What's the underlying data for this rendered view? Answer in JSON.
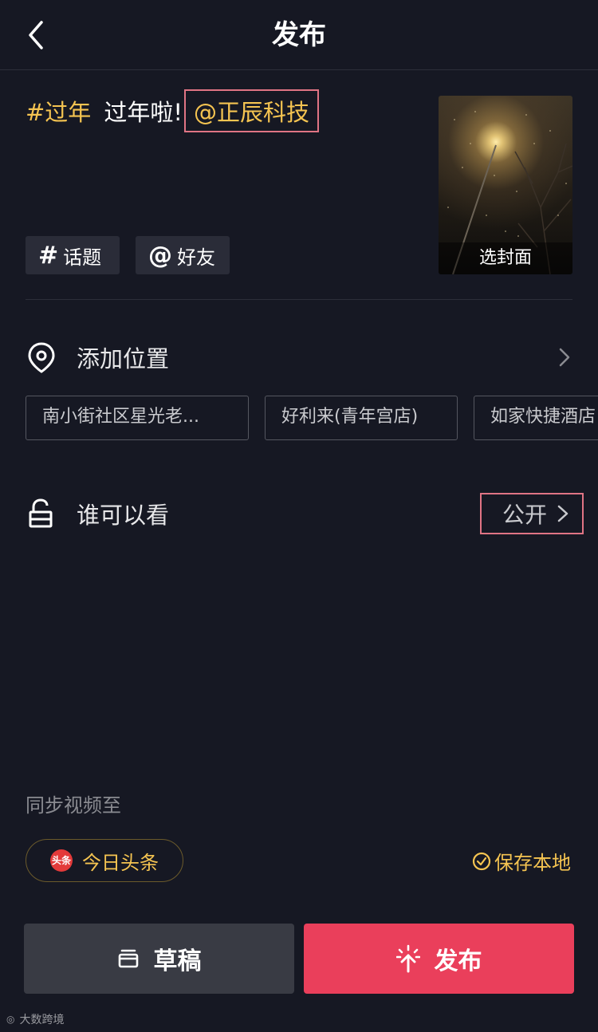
{
  "header": {
    "title": "发布",
    "back_icon": "chevron-left-icon"
  },
  "caption": {
    "hashtag": "#过年",
    "text": "过年啦!",
    "mention": "@正辰科技"
  },
  "chips": {
    "topic": {
      "glyph": "#",
      "label": "话题"
    },
    "friend": {
      "glyph": "@",
      "label": "好友"
    }
  },
  "cover": {
    "label": "选封面"
  },
  "location": {
    "label": "添加位置",
    "icon": "location-pin-icon",
    "suggestions": [
      "南小街社区星光老...",
      "好利来(青年宫店)",
      "如家快捷酒店"
    ]
  },
  "privacy": {
    "label": "谁可以看",
    "value": "公开",
    "icon": "unlock-icon"
  },
  "sync": {
    "label": "同步视频至",
    "toutiao": {
      "logo_text": "头条",
      "label": "今日头条"
    },
    "save_local": "保存本地"
  },
  "actions": {
    "draft": "草稿",
    "publish": "发布"
  },
  "watermark": {
    "text": "大数跨境"
  },
  "colors": {
    "background": "#161823",
    "accent_yellow": "#f5c451",
    "publish_red": "#ea3f5b",
    "highlight_border": "#e07484"
  }
}
